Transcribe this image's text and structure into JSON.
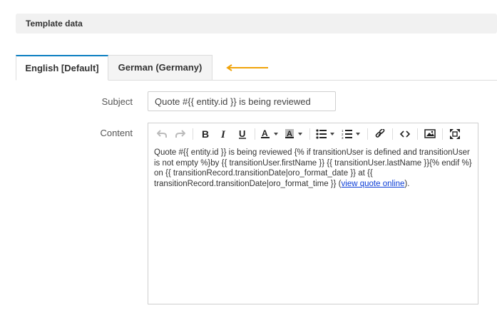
{
  "section": {
    "title": "Template data"
  },
  "tabs": [
    {
      "label": "English [Default]",
      "active": true
    },
    {
      "label": "German (Germany)",
      "active": false
    }
  ],
  "form": {
    "subject_label": "Subject",
    "subject_value": "Quote #{{ entity.id }} is being reviewed",
    "content_label": "Content"
  },
  "editor": {
    "toolbar": [
      "undo-icon",
      "redo-icon",
      "bold-icon",
      "italic-icon",
      "underline-icon",
      "font-color-icon",
      "background-color-icon",
      "bullet-list-icon",
      "numbered-list-icon",
      "link-icon",
      "source-code-icon",
      "image-icon",
      "fullscreen-icon"
    ],
    "content_text": "Quote #{{ entity.id }} is being reviewed {% if transitionUser is defined and transitionUser is not empty %}by {{ transitionUser.firstName }} {{ transitionUser.lastName }}{% endif %} on {{ transitionRecord.transitionDate|oro_format_date }} at {{ transitionRecord.transitionDate|oro_format_time }} (",
    "content_link": "view quote online",
    "content_tail": ")."
  },
  "colors": {
    "accent": "#0c7fc1",
    "arrow": "#f0a30a",
    "link": "#0a3cd6"
  }
}
